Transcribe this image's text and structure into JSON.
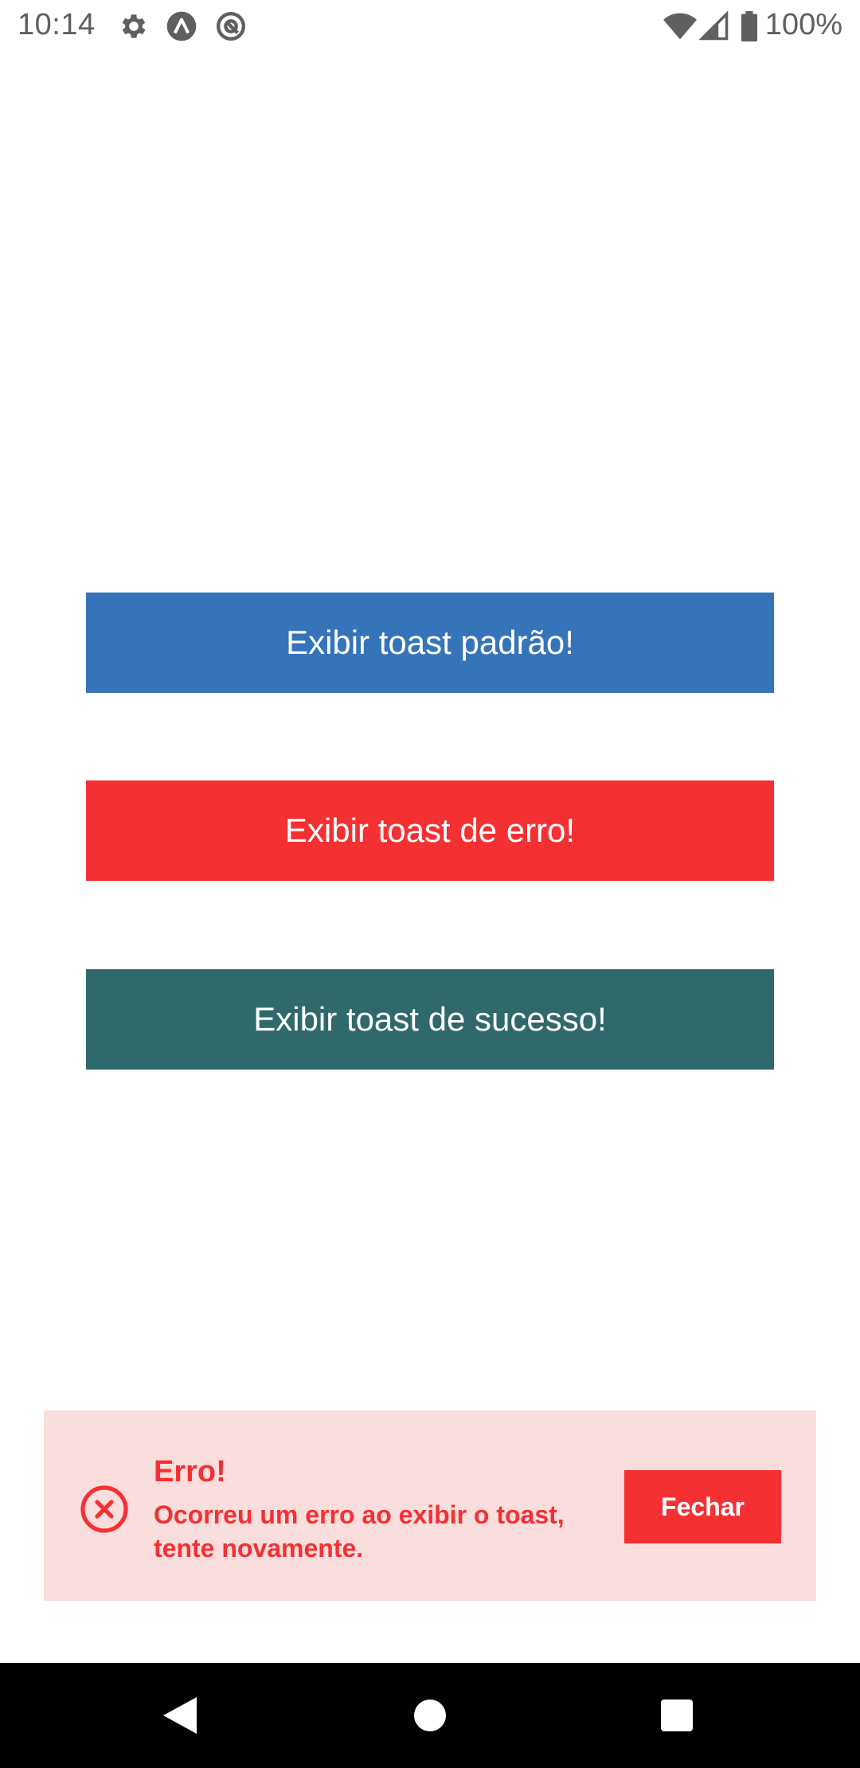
{
  "status_bar": {
    "time": "10:14",
    "left_icons": [
      "gear-icon",
      "expo-a-icon",
      "at-sign-icon"
    ],
    "right_icons": [
      "wifi-icon",
      "cell-signal-icon",
      "battery-icon"
    ],
    "battery": "100%"
  },
  "buttons": {
    "default_label": "Exibir toast padrão!",
    "error_label": "Exibir toast de erro!",
    "success_label": "Exibir toast de sucesso!"
  },
  "toast": {
    "icon": "error-circle-icon",
    "title": "Erro!",
    "message": "Ocorreu um erro ao exibir o toast, tente novamente.",
    "close_label": "Fechar"
  },
  "nav_bar": {
    "icons": [
      "back-icon",
      "home-icon",
      "recents-icon"
    ]
  },
  "colors": {
    "default_button": "#3574b9",
    "error_button": "#f53033",
    "success_button": "#30696b",
    "toast_background": "#fadddd",
    "toast_text": "#f53033",
    "status_text": "#5f5f5f",
    "nav_background": "#000000"
  }
}
